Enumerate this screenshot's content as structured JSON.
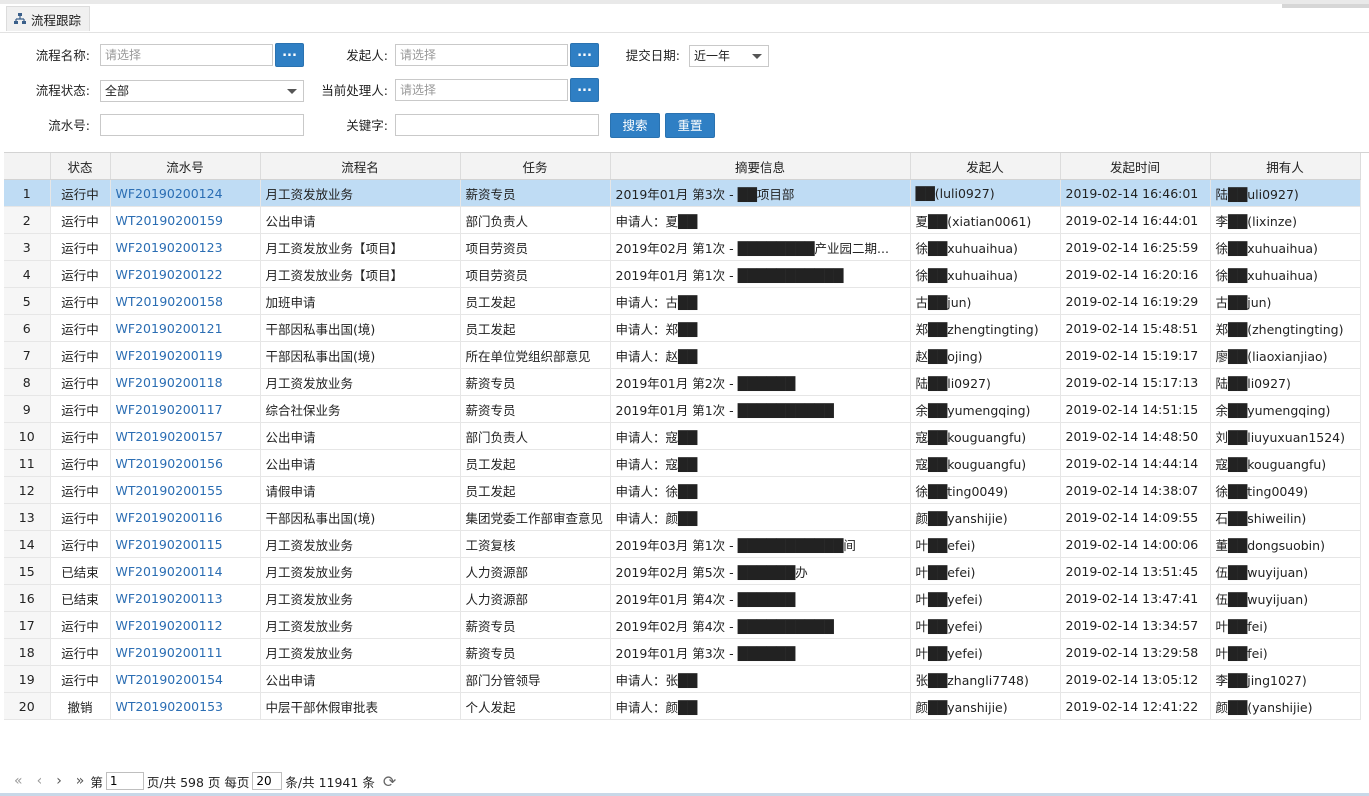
{
  "tab": {
    "title": "流程跟踪",
    "icon": "org-chart-icon"
  },
  "filters": {
    "flow_name": {
      "label": "流程名称:",
      "placeholder": "请选择"
    },
    "initiator": {
      "label": "发起人:",
      "placeholder": "请选择"
    },
    "submit_date": {
      "label": "提交日期:",
      "value": "近一年"
    },
    "flow_status": {
      "label": "流程状态:",
      "value": "全部"
    },
    "current_handler": {
      "label": "当前处理人:",
      "placeholder": "请选择"
    },
    "serial_no": {
      "label": "流水号:",
      "value": ""
    },
    "keyword": {
      "label": "关键字:",
      "value": ""
    },
    "dots": "...",
    "search_label": "搜索",
    "reset_label": "重置"
  },
  "table": {
    "columns": [
      "",
      "状态",
      "流水号",
      "流程名",
      "任务",
      "摘要信息",
      "发起人",
      "发起时间",
      "拥有人"
    ],
    "selected_row": 0,
    "rows": [
      {
        "no": "1",
        "status": "运行中",
        "serial": "WF20190200124",
        "flow": "月工资发放业务",
        "task": "薪资专员",
        "summary": "2019年01月 第3次 - ██项目部",
        "initiator": "██(luli0927)",
        "time": "2019-02-14 16:46:01",
        "owner": "陆██uli0927)"
      },
      {
        "no": "2",
        "status": "运行中",
        "serial": "WT20190200159",
        "flow": "公出申请",
        "task": "部门负责人",
        "summary": "申请人：夏██",
        "initiator": "夏██(xiatian0061)",
        "time": "2019-02-14 16:44:01",
        "owner": "李██(lixinze)"
      },
      {
        "no": "3",
        "status": "运行中",
        "serial": "WF20190200123",
        "flow": "月工资发放业务【项目】",
        "task": "项目劳资员",
        "summary": "2019年02月 第1次 - ████████产业园二期...",
        "initiator": "徐██xuhuaihua)",
        "time": "2019-02-14 16:25:59",
        "owner": "徐██xuhuaihua)"
      },
      {
        "no": "4",
        "status": "运行中",
        "serial": "WF20190200122",
        "flow": "月工资发放业务【项目】",
        "task": "项目劳资员",
        "summary": "2019年01月 第1次 - ███████████",
        "initiator": "徐██xuhuaihua)",
        "time": "2019-02-14 16:20:16",
        "owner": "徐██xuhuaihua)"
      },
      {
        "no": "5",
        "status": "运行中",
        "serial": "WT20190200158",
        "flow": "加班申请",
        "task": "员工发起",
        "summary": "申请人：古██",
        "initiator": "古██jun)",
        "time": "2019-02-14 16:19:29",
        "owner": "古██jun)"
      },
      {
        "no": "6",
        "status": "运行中",
        "serial": "WF20190200121",
        "flow": "干部因私事出国(境)",
        "task": "员工发起",
        "summary": "申请人：郑██",
        "initiator": "郑██zhengtingting)",
        "time": "2019-02-14 15:48:51",
        "owner": "郑██(zhengtingting)"
      },
      {
        "no": "7",
        "status": "运行中",
        "serial": "WF20190200119",
        "flow": "干部因私事出国(境)",
        "task": "所在单位党组织部意见",
        "summary": "申请人：赵██",
        "initiator": "赵██ojing)",
        "time": "2019-02-14 15:19:17",
        "owner": "廖██(liaoxianjiao)"
      },
      {
        "no": "8",
        "status": "运行中",
        "serial": "WF20190200118",
        "flow": "月工资发放业务",
        "task": "薪资专员",
        "summary": "2019年01月 第2次 - ██████",
        "initiator": "陆██li0927)",
        "time": "2019-02-14 15:17:13",
        "owner": "陆██li0927)"
      },
      {
        "no": "9",
        "status": "运行中",
        "serial": "WF20190200117",
        "flow": "综合社保业务",
        "task": "薪资专员",
        "summary": "2019年01月 第1次 - ██████████",
        "initiator": "余██yumengqing)",
        "time": "2019-02-14 14:51:15",
        "owner": "余██yumengqing)"
      },
      {
        "no": "10",
        "status": "运行中",
        "serial": "WT20190200157",
        "flow": "公出申请",
        "task": "部门负责人",
        "summary": "申请人：寇██",
        "initiator": "寇██kouguangfu)",
        "time": "2019-02-14 14:48:50",
        "owner": "刘██liuyuxuan1524)"
      },
      {
        "no": "11",
        "status": "运行中",
        "serial": "WT20190200156",
        "flow": "公出申请",
        "task": "员工发起",
        "summary": "申请人：寇██",
        "initiator": "寇██kouguangfu)",
        "time": "2019-02-14 14:44:14",
        "owner": "寇██kouguangfu)"
      },
      {
        "no": "12",
        "status": "运行中",
        "serial": "WT20190200155",
        "flow": "请假申请",
        "task": "员工发起",
        "summary": "申请人：徐██",
        "initiator": "徐██ting0049)",
        "time": "2019-02-14 14:38:07",
        "owner": "徐██ting0049)"
      },
      {
        "no": "13",
        "status": "运行中",
        "serial": "WF20190200116",
        "flow": "干部因私事出国(境)",
        "task": "集团党委工作部审查意见",
        "summary": "申请人：颜██",
        "initiator": "颜██yanshijie)",
        "time": "2019-02-14 14:09:55",
        "owner": "石██shiweilin)"
      },
      {
        "no": "14",
        "status": "运行中",
        "serial": "WF20190200115",
        "flow": "月工资发放业务",
        "task": "工资复核",
        "summary": "2019年03月 第1次 - ███████████间",
        "initiator": "叶██efei)",
        "time": "2019-02-14 14:00:06",
        "owner": "董██dongsuobin)"
      },
      {
        "no": "15",
        "status": "已结束",
        "serial": "WF20190200114",
        "flow": "月工资发放业务",
        "task": "人力资源部",
        "summary": "2019年02月 第5次 - ██████办",
        "initiator": "叶██efei)",
        "time": "2019-02-14 13:51:45",
        "owner": "伍██wuyijuan)"
      },
      {
        "no": "16",
        "status": "已结束",
        "serial": "WF20190200113",
        "flow": "月工资发放业务",
        "task": "人力资源部",
        "summary": "2019年01月 第4次 - ██████",
        "initiator": "叶██yefei)",
        "time": "2019-02-14 13:47:41",
        "owner": "伍██wuyijuan)"
      },
      {
        "no": "17",
        "status": "运行中",
        "serial": "WF20190200112",
        "flow": "月工资发放业务",
        "task": "薪资专员",
        "summary": "2019年02月 第4次 - ██████████",
        "initiator": "叶██yefei)",
        "time": "2019-02-14 13:34:57",
        "owner": "叶██fei)"
      },
      {
        "no": "18",
        "status": "运行中",
        "serial": "WF20190200111",
        "flow": "月工资发放业务",
        "task": "薪资专员",
        "summary": "2019年01月 第3次 - ██████",
        "initiator": "叶██yefei)",
        "time": "2019-02-14 13:29:58",
        "owner": "叶██fei)"
      },
      {
        "no": "19",
        "status": "运行中",
        "serial": "WT20190200154",
        "flow": "公出申请",
        "task": "部门分管领导",
        "summary": "申请人：张██",
        "initiator": "张██zhangli7748)",
        "time": "2019-02-14 13:05:12",
        "owner": "李██jing1027)"
      },
      {
        "no": "20",
        "status": "撤销",
        "serial": "WT20190200153",
        "flow": "中层干部休假审批表",
        "task": "个人发起",
        "summary": "申请人：颜██",
        "initiator": "颜██yanshijie)",
        "time": "2019-02-14 12:41:22",
        "owner": "颜██(yanshijie)"
      }
    ]
  },
  "pager": {
    "first": "«",
    "prev": "‹",
    "next": "›",
    "last": "»",
    "page_prefix": "第",
    "page_value": "1",
    "page_suffix": "页/共 598 页 每页",
    "page_size": "20",
    "total_text": "条/共 11941 条",
    "refresh": "⟳"
  }
}
